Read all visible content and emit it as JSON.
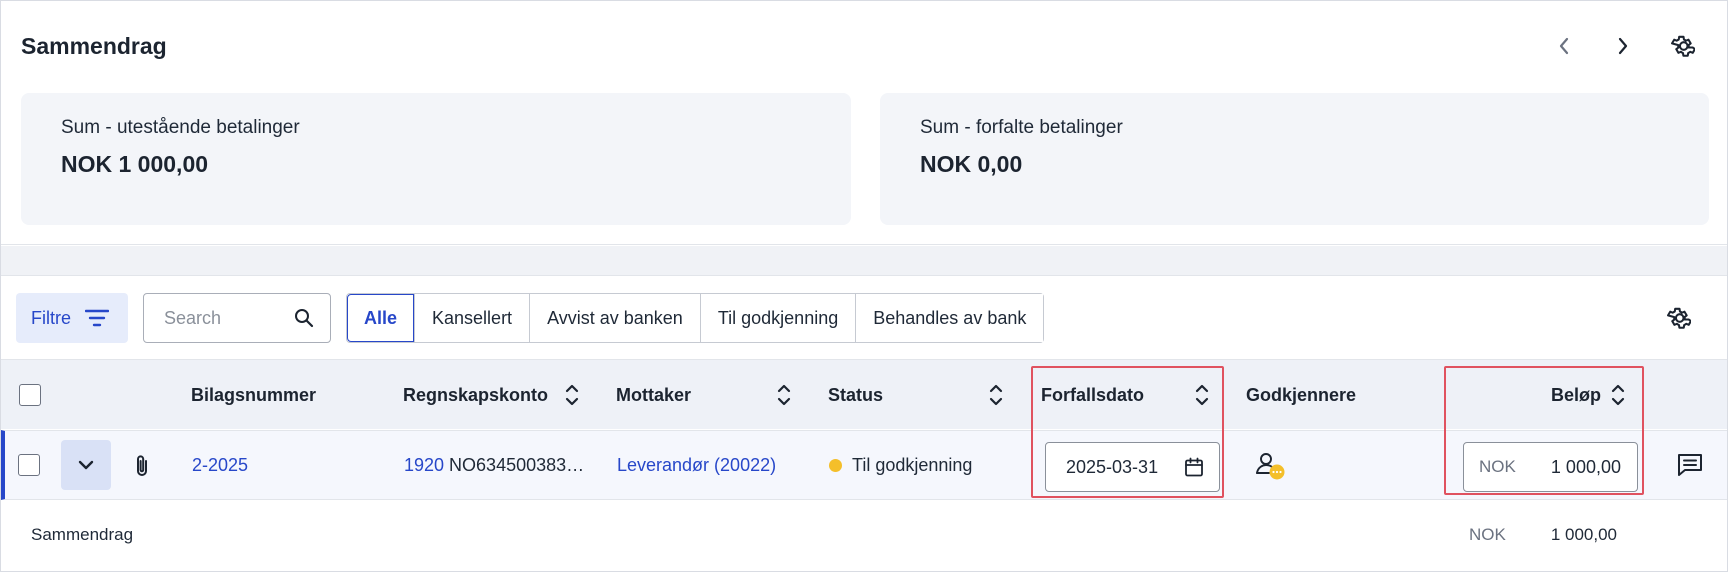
{
  "summary": {
    "title": "Sammendrag",
    "cards": [
      {
        "label": "Sum - utestående betalinger",
        "value": "NOK 1 000,00"
      },
      {
        "label": "Sum - forfalte betalinger",
        "value": "NOK 0,00"
      }
    ]
  },
  "toolbar": {
    "filter_label": "Filtre",
    "search_placeholder": "Search",
    "segments": [
      "Alle",
      "Kansellert",
      "Avvist av banken",
      "Til godkjenning",
      "Behandles av bank"
    ],
    "active_segment": "Alle"
  },
  "table": {
    "headers": {
      "bilagsnummer": "Bilagsnummer",
      "regnskapskonto": "Regnskapskonto",
      "mottaker": "Mottaker",
      "status": "Status",
      "forfallsdato": "Forfallsdato",
      "godkjennere": "Godkjennere",
      "belop": "Beløp"
    },
    "rows": [
      {
        "bilagsnummer": "2-2025",
        "konto_nr": "1920",
        "konto_iban": "NO634500383…",
        "mottaker": "Leverandør (20022)",
        "status": "Til godkjenning",
        "status_color": "#f4bf2a",
        "forfallsdato": "2025-03-31",
        "currency": "NOK",
        "amount": "1 000,00"
      }
    ]
  },
  "footer": {
    "label": "Sammendrag",
    "currency": "NOK",
    "total": "1 000,00"
  },
  "colors": {
    "accent": "#2747c9",
    "highlight": "#e0525f"
  }
}
